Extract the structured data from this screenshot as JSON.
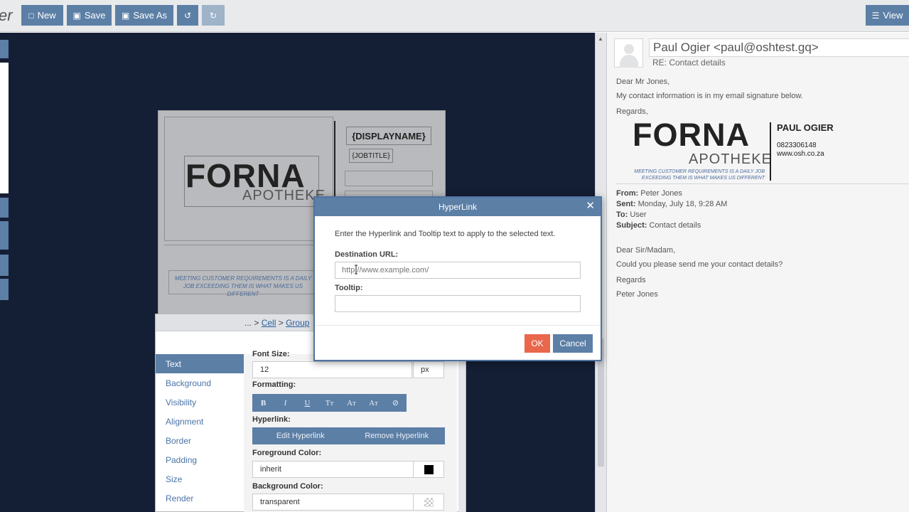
{
  "toolbar": {
    "brand": "er",
    "new_label": "New",
    "save_label": "Save",
    "save_as_label": "Save As",
    "view_label": "View"
  },
  "template": {
    "logo_main": "FORNA",
    "logo_sub": "APOTHEKE",
    "display_name": "{DISPLAYNAME}",
    "job_title": "{JOBTITLE}",
    "tagline": "MEETING CUSTOMER REQUIREMENTS IS A DAILY JOB EXCEEDING THEM IS WHAT MAKES US DIFFERENT"
  },
  "properties": {
    "breadcrumb_prefix": "... >",
    "breadcrumb_cell": "Cell",
    "breadcrumb_sep": ">",
    "breadcrumb_group": "Group",
    "side_items": [
      "Text",
      "Background",
      "Visibility",
      "Alignment",
      "Border",
      "Padding",
      "Size",
      "Render"
    ],
    "font_size_label": "Font Size:",
    "font_size_value": "12",
    "font_unit": "px",
    "formatting_label": "Formatting:",
    "format_buttons": [
      "B",
      "I",
      "U",
      "Tт",
      "Aт",
      "Aт",
      "⊘"
    ],
    "hyperlink_label": "Hyperlink:",
    "edit_hyperlink": "Edit Hyperlink",
    "remove_hyperlink": "Remove Hyperlink",
    "foreground_label": "Foreground Color:",
    "foreground_value": "inherit",
    "background_label": "Background Color:",
    "background_value": "transparent"
  },
  "email": {
    "from": "Paul Ogier <paul@oshtest.gq>",
    "subject_line": "RE: Contact details",
    "greeting": "Dear Mr Jones,",
    "body1": "My contact information is in my email signature below.",
    "regards": "Regards,",
    "sig_logo": "FORNA",
    "sig_sub": "APOTHEKE",
    "sig_tagline": "MEETING CUSTOMER REQUIREMENTS IS A DAILY JOB EXCEEDING THEM IS WHAT MAKES US DIFFERENT",
    "sig_name": "PAUL OGIER",
    "sig_phone": "0823306148",
    "sig_web": "www.osh.co.za",
    "from_label": "From:",
    "from_value": "Peter Jones",
    "sent_label": "Sent:",
    "sent_value": "Monday, July 18, 9:28 AM",
    "to_label": "To:",
    "to_value": "User",
    "subj_label": "Subject:",
    "subj_value": "Contact details",
    "dear2": "Dear Sir/Madam,",
    "body2": "Could you please send me your contact details?",
    "regards2": "Regards",
    "signoff": "Peter Jones"
  },
  "dialog": {
    "title": "HyperLink",
    "close_glyph": "✕",
    "intro": "Enter the Hyperlink and Tooltip text to apply to the selected text.",
    "url_label": "Destination URL:",
    "url_placeholder": "http://www.example.com/",
    "tooltip_label": "Tooltip:",
    "tooltip_value": "",
    "ok_label": "OK",
    "cancel_label": "Cancel"
  },
  "colors": {
    "accent": "#5c7fa6",
    "ok": "#e9674b",
    "canvas": "#141e34"
  },
  "icons": [
    "file-icon",
    "save-icon",
    "save-as-icon",
    "undo-icon",
    "redo-icon",
    "view-icon",
    "close-icon",
    "avatar-icon"
  ]
}
